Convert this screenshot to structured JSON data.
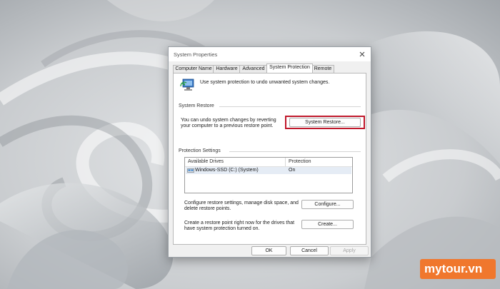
{
  "window": {
    "title": "System Properties"
  },
  "tabs": [
    {
      "label": "Computer Name",
      "active": false
    },
    {
      "label": "Hardware",
      "active": false
    },
    {
      "label": "Advanced",
      "active": false
    },
    {
      "label": "System Protection",
      "active": true
    },
    {
      "label": "Remote",
      "active": false
    }
  ],
  "intro": {
    "text": "Use system protection to undo unwanted system changes.",
    "icon": "system-protection-icon"
  },
  "system_restore": {
    "label": "System Restore",
    "description_line1": "You can undo system changes by reverting",
    "description_line2": "your computer to a previous restore point.",
    "button_label": "System Restore...",
    "highlight_color": "#c0182b"
  },
  "protection_settings": {
    "label": "Protection Settings",
    "columns": [
      "Available Drives",
      "Protection"
    ],
    "drives": [
      {
        "name": "Windows-SSD (C:) (System)",
        "protection": "On",
        "icon": "drive-icon"
      }
    ],
    "configure_text_line1": "Configure restore settings, manage disk space, and",
    "configure_text_line2": "delete restore points.",
    "configure_button": "Configure...",
    "create_text_line1": "Create a restore point right now for the drives that",
    "create_text_line2": "have system protection turned on.",
    "create_button": "Create..."
  },
  "footer": {
    "ok": "OK",
    "cancel": "Cancel",
    "apply": "Apply"
  },
  "watermark": {
    "text": "mytour.vn",
    "color": "#f0772d"
  }
}
